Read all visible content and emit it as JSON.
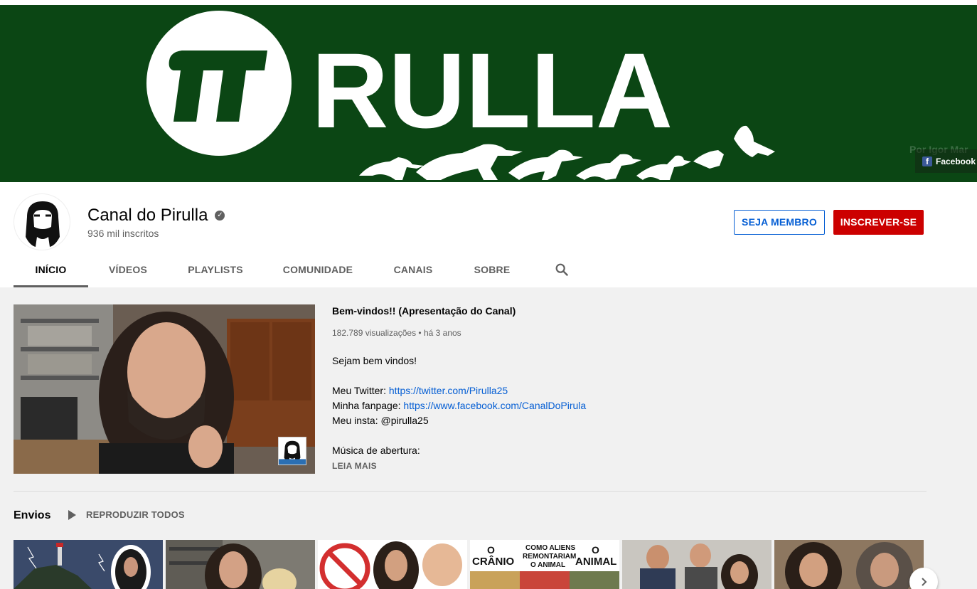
{
  "banner": {
    "logo_text": "RULLA",
    "credit_text": "Por Igor Mar",
    "facebook_label": "Facebook"
  },
  "channel": {
    "name": "Canal do Pirulla",
    "subscribers": "936 mil inscritos",
    "member_button": "SEJA MEMBRO",
    "subscribe_button": "INSCREVER-SE"
  },
  "tabs": [
    {
      "label": "INÍCIO",
      "active": true
    },
    {
      "label": "VÍDEOS",
      "active": false
    },
    {
      "label": "PLAYLISTS",
      "active": false
    },
    {
      "label": "COMUNIDADE",
      "active": false
    },
    {
      "label": "CANAIS",
      "active": false
    },
    {
      "label": "SOBRE",
      "active": false
    }
  ],
  "featured": {
    "title": "Bem-vindos!! (Apresentação do Canal)",
    "views": "182.789 visualizações",
    "age": "há 3 anos",
    "desc_line1": "Sejam bem vindos!",
    "twitter_label": "Meu Twitter: ",
    "twitter_url": "https://twitter.com/Pirulla25",
    "fanpage_label": "Minha fanpage: ",
    "fanpage_url": "https://www.facebook.com/CanalDoPirula",
    "insta": "Meu insta: @pirulla25",
    "music": "Música de abertura:",
    "read_more": "LEIA MAIS"
  },
  "uploads": {
    "title": "Envios",
    "play_all": "REPRODUZIR TODOS",
    "thumb4_text": {
      "left_o": "O",
      "left_word": "CRÂNIO",
      "center_line1": "COMO ALIENS",
      "center_line2": "REMONTARIAM",
      "center_line3": "O ANIMAL",
      "right_o": "O",
      "right_word": "ANIMAL"
    }
  },
  "colors": {
    "banner_green": "#0b4614",
    "subscribe_red": "#cc0000",
    "link_blue": "#065fd4"
  }
}
